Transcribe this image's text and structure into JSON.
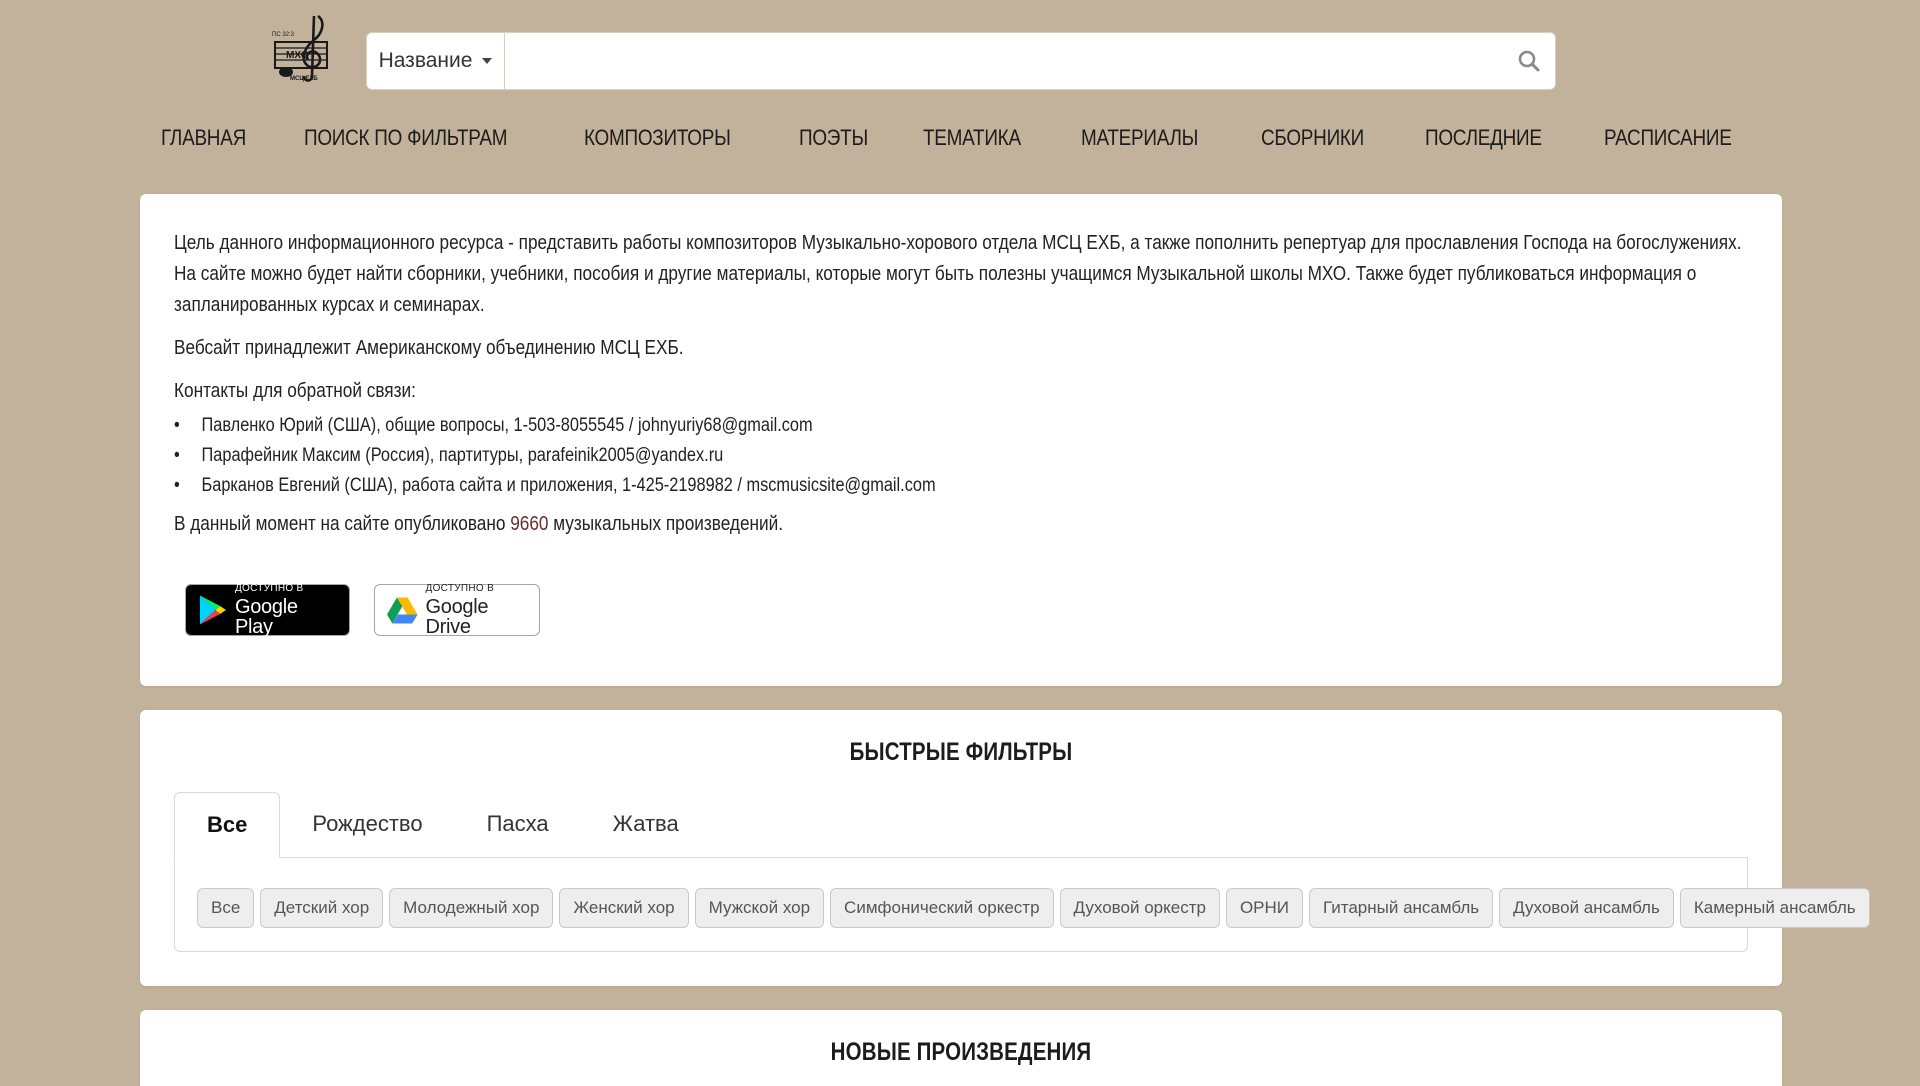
{
  "header": {
    "logo_text": "МХО МСЦ ЕХБ",
    "search": {
      "select_label": "Название",
      "placeholder": "",
      "value": ""
    }
  },
  "nav": {
    "items": [
      "ГЛАВНАЯ",
      "ПОИСК ПО ФИЛЬТРАМ",
      "КОМПОЗИТОРЫ",
      "ПОЭТЫ",
      "ТЕМАТИКА",
      "МАТЕРИАЛЫ",
      "СБОРНИКИ",
      "ПОСЛЕДНИЕ",
      "РАСПИСАНИЕ"
    ]
  },
  "about": {
    "intro": "Цель данного информационного ресурса - представить работы композиторов Музыкально-хорового отдела МСЦ ЕХБ, а также пополнить репертуар для прославления Господа на богослужениях. На сайте можно будет найти сборники, учебники, пособия и другие материалы, которые могут быть полезны учащимся Музыкальной школы МХО. Также будет публиковаться информация о запланированных курсах и семинарах.",
    "owner": "Вебсайт принадлежит Американскому объединению МСЦ ЕХБ.",
    "contacts_title": "Контакты для обратной связи:",
    "contacts": [
      "Павленко Юрий (США), общие вопросы, 1-503-8055545 / johnyuriy68@gmail.com",
      "Парафейник Максим (Россия), партитуры, parafeinik2005@yandex.ru",
      "Барканов Евгений (США), работа сайта и приложения, 1-425-2198982 / mscmusicsite@gmail.com"
    ],
    "count_prefix": "В данный момент на сайте опубликовано",
    "count_value": "9660",
    "count_suffix": "музыкальных произведений.",
    "badges": {
      "play": {
        "small": "ДОСТУПНО В",
        "big": "Google Play"
      },
      "drive": {
        "small": "ДОСТУПНО В",
        "big": "Google Drive"
      }
    }
  },
  "quick_filters": {
    "title": "БЫСТРЫЕ ФИЛЬТРЫ",
    "tabs": [
      "Все",
      "Рождество",
      "Пасха",
      "Жатва"
    ],
    "active_tab": 0,
    "chips": [
      "Все",
      "Детский хор",
      "Молодежный хор",
      "Женский хор",
      "Мужской хор",
      "Симфонический оркестр",
      "Духовой оркестр",
      "ОРНИ",
      "Гитарный ансамбль",
      "Духовой ансамбль",
      "Камерный ансамбль"
    ]
  },
  "new_works": {
    "title": "НОВЫЕ ПРОИЗВЕДЕНИЯ"
  },
  "colors": {
    "background": "#c2b29b",
    "card": "#ffffff",
    "count_accent": "#6b2d2d"
  }
}
